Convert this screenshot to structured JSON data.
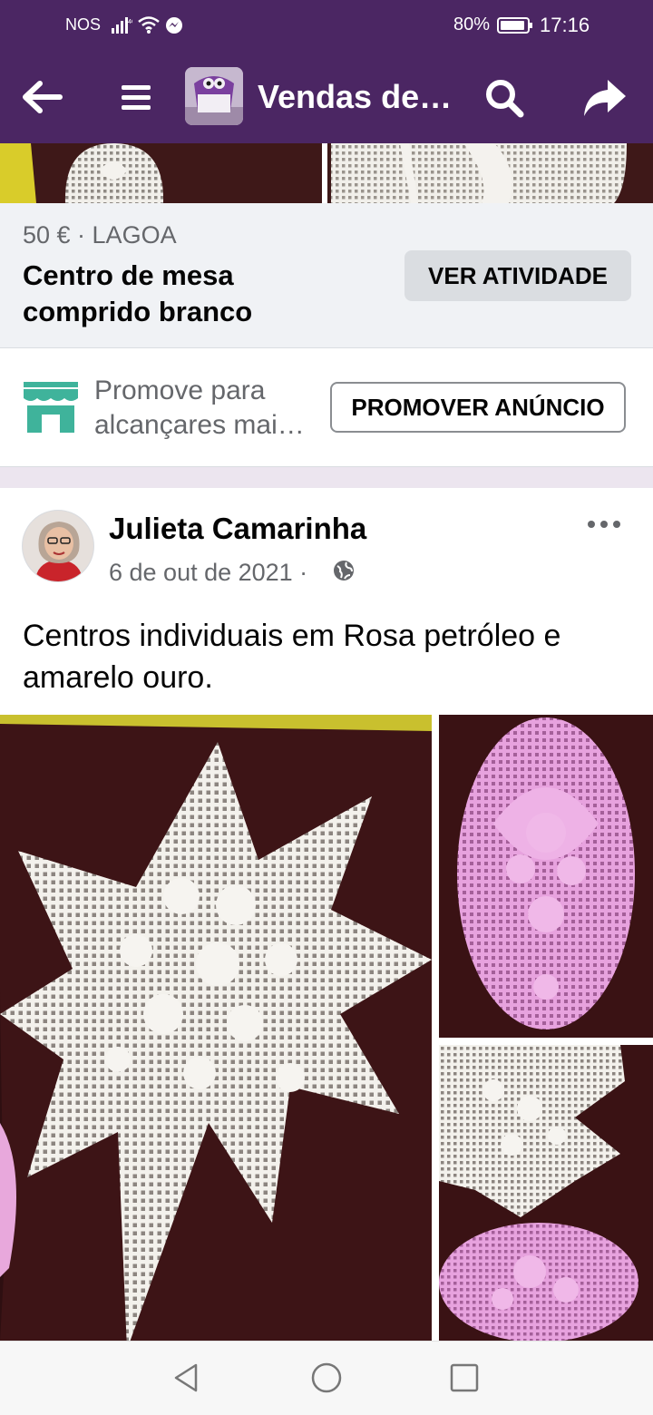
{
  "status_bar": {
    "carrier": "NOS",
    "battery_percent": "80%",
    "time": "17:16",
    "icons": [
      "signal-icon",
      "wifi-icon",
      "messenger-icon",
      "battery-icon"
    ]
  },
  "app_bar": {
    "title": "Vendas de…",
    "icons": [
      "back-arrow-icon",
      "menu-icon",
      "group-avatar",
      "search-icon",
      "share-icon"
    ]
  },
  "listing": {
    "meta": "50 € · LAGOA",
    "title": "Centro de mesa comprido branco",
    "activity_button": "VER ATIVIDADE"
  },
  "promote": {
    "line1": "Promove para",
    "line2": "alcançares mai…",
    "button": "PROMOVER ANÚNCIO",
    "icon": "storefront-icon"
  },
  "post": {
    "author": "Julieta Camarinha",
    "date": "6 de out de 2021 ·",
    "audience_icon": "globe-icon",
    "text": "Centros individuais em Rosa petróleo e amarelo ouro.",
    "photos": [
      "white-star-doily",
      "pink-oval-doily",
      "white-doily-and-pink-doily"
    ]
  },
  "colors": {
    "brand_purple": "#4b2663",
    "secondary_text": "#65676b",
    "button_gray": "#dadde1",
    "promote_green": "#3fb39b"
  },
  "nav_bar": {
    "icons": [
      "nav-back-icon",
      "nav-home-icon",
      "nav-recents-icon"
    ]
  }
}
